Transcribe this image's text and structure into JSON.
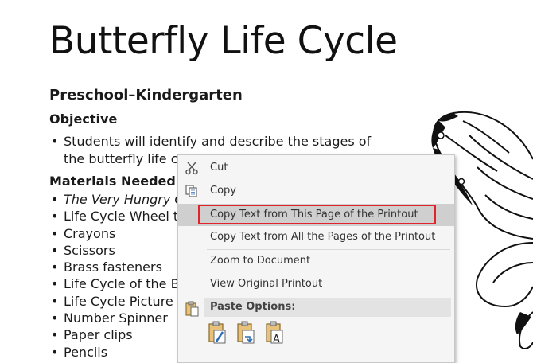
{
  "document": {
    "title": "Butterfly Life Cycle",
    "grade": "Preschool–Kindergarten",
    "objective_heading": "Objective",
    "objective_bullet": "Students will identify and describe the stages of the butterfly life cycle.",
    "materials_heading": "Materials Needed",
    "materials": [
      "The Very Hungry C",
      "Life Cycle Wheel ter",
      "Crayons",
      "Scissors",
      "Brass fasteners",
      "Life Cycle of the But",
      "Life Cycle Picture Co",
      "Number Spinner",
      "Paper clips",
      "Pencils"
    ]
  },
  "context_menu": {
    "cut": "Cut",
    "copy": "Copy",
    "copy_text_this_page": "Copy Text from This Page of the Printout",
    "copy_text_all_pages": "Copy Text from All the Pages of the Printout",
    "zoom_to_document": "Zoom to Document",
    "view_original_printout": "View Original Printout",
    "paste_options": "Paste Options:",
    "icons": {
      "cut": "scissors-icon",
      "copy": "copy-icon",
      "paste": "clipboard-icon",
      "paste_keep_source": "paste-keep-source-icon",
      "paste_merge": "paste-merge-icon",
      "paste_text_only": "paste-text-only-icon"
    },
    "highlight_color": "#e0242a"
  }
}
